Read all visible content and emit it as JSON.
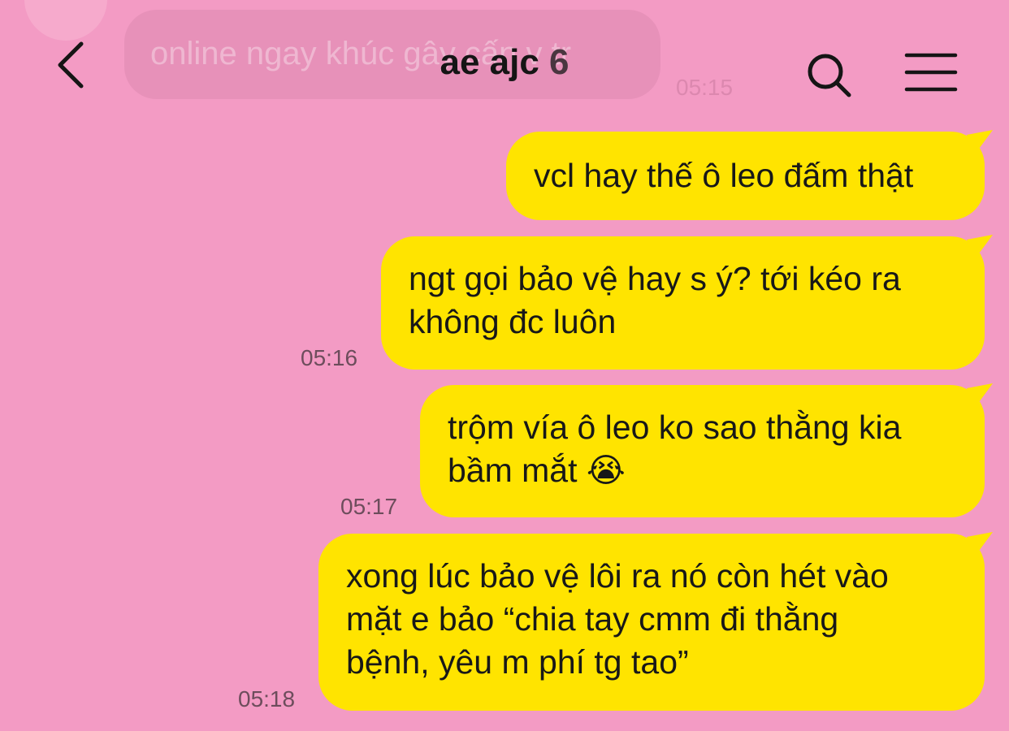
{
  "header": {
    "title": "ae ajc",
    "count": "6"
  },
  "ghost_message": {
    "text": "online ngay khúc gây cấn v tr",
    "time": "05:15"
  },
  "messages": [
    {
      "text": "vcl hay thế ô leo đấm thật",
      "time": ""
    },
    {
      "text": "ngt gọi bảo vệ hay s ý? tới kéo ra\nkhông đc luôn",
      "time": "05:16"
    },
    {
      "text": "trộm vía ô leo ko sao thằng kia\nbầm mắt 😭",
      "time": "05:17"
    },
    {
      "text": "xong lúc bảo vệ lôi ra nó còn hét vào\nmặt e bảo “chia tay cmm đi thằng\nbệnh, yêu m phí tg tao”",
      "time": "05:18"
    }
  ],
  "icons": {
    "back": "chevron-left-icon",
    "search": "search-icon",
    "menu": "hamburger-menu-icon"
  },
  "colors": {
    "background": "#f39bc4",
    "bubble": "#ffe400",
    "text": "#181818",
    "time": "#6d4d5c"
  }
}
